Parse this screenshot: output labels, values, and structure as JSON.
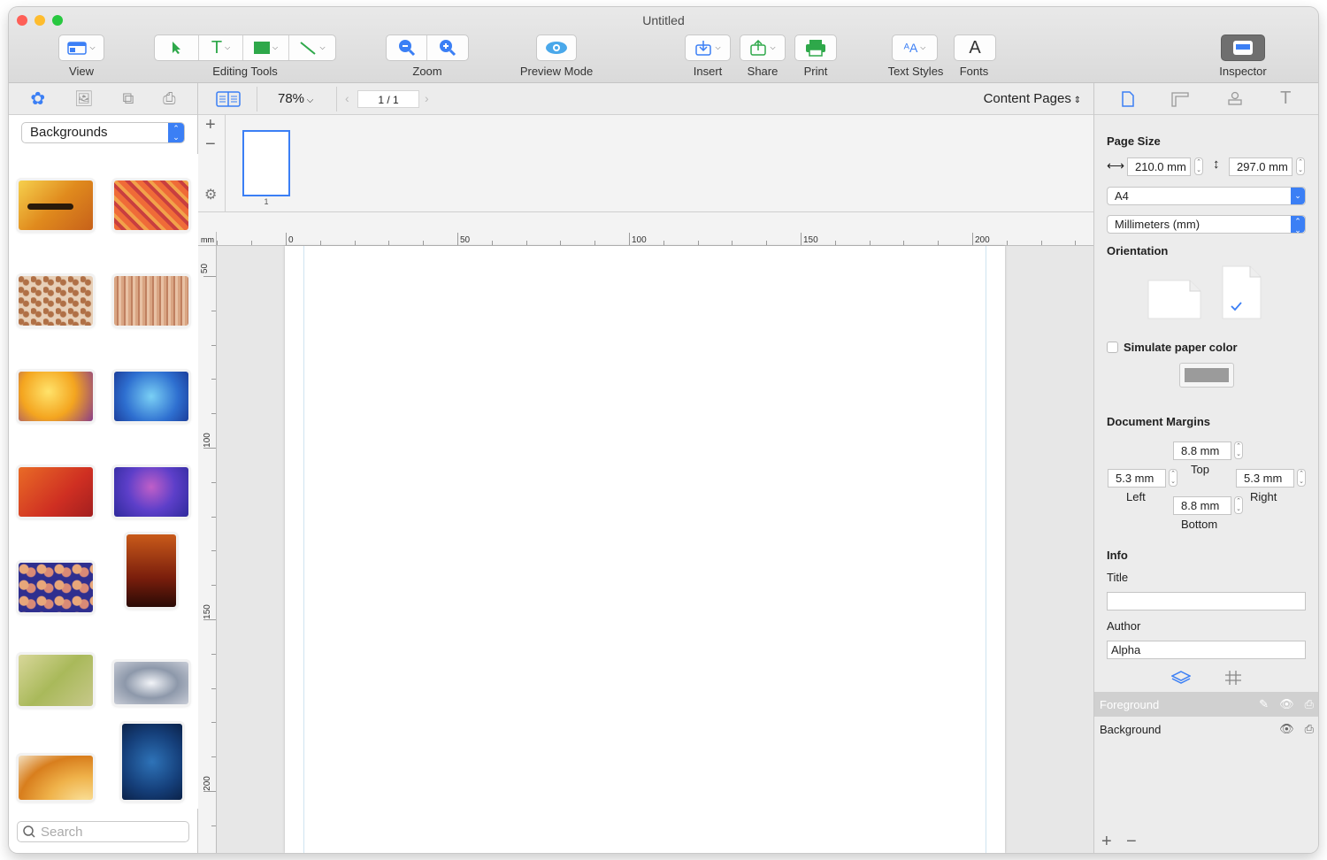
{
  "window": {
    "title": "Untitled"
  },
  "toolbar": {
    "view": "View",
    "editing_tools": "Editing Tools",
    "zoom": "Zoom",
    "preview_mode": "Preview Mode",
    "insert": "Insert",
    "share": "Share",
    "print": "Print",
    "text_styles": "Text Styles",
    "fonts": "Fonts",
    "inspector": "Inspector"
  },
  "library": {
    "category": "Backgrounds",
    "search_placeholder": "Search",
    "thumbnail_count": 14
  },
  "canvas": {
    "zoom": "78%",
    "page_indicator": "1 / 1",
    "page_number": "1",
    "view_mode": "Content Pages",
    "ruler_unit": "mm",
    "h_ruler_labels": [
      "0",
      "50",
      "100",
      "150",
      "200"
    ],
    "v_ruler_labels": [
      "50",
      "100",
      "150",
      "200"
    ]
  },
  "inspector": {
    "page_size_title": "Page Size",
    "width": "210.0 mm",
    "height": "297.0 mm",
    "paper": "A4",
    "units": "Millimeters (mm)",
    "orientation_title": "Orientation",
    "selected_orientation": "portrait",
    "simulate_paper_color": "Simulate paper color",
    "paper_color": "#9b9b9b",
    "margins_title": "Document Margins",
    "margin_top": "8.8 mm",
    "margin_top_label": "Top",
    "margin_left": "5.3 mm",
    "margin_left_label": "Left",
    "margin_right": "5.3 mm",
    "margin_right_label": "Right",
    "margin_bottom": "8.8 mm",
    "margin_bottom_label": "Bottom",
    "info_title": "Info",
    "title_label": "Title",
    "title_value": "",
    "author_label": "Author",
    "author_value": "Alpha"
  },
  "layers": [
    {
      "name": "Foreground",
      "selected": true
    },
    {
      "name": "Background",
      "selected": false
    }
  ],
  "colors": {
    "accent": "#3b7ff5",
    "selection": "#d0d0d0"
  }
}
